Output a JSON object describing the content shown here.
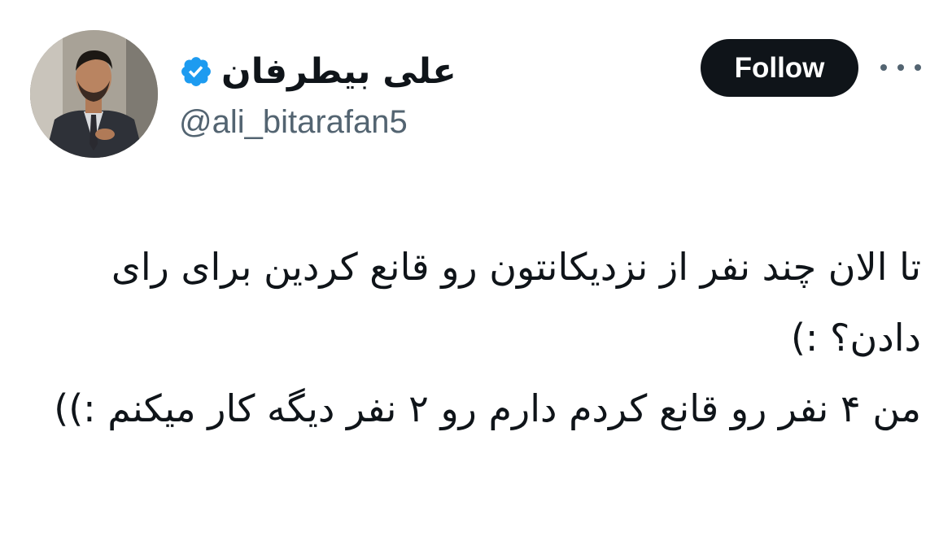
{
  "author": {
    "display_name": "علی بیطرفان",
    "handle": "@ali_bitarafan5",
    "verified_badge": "verified-badge-icon",
    "badge_color": "#1d9bf0"
  },
  "actions": {
    "follow_label": "Follow",
    "more_icon": "more-horizontal-icon"
  },
  "tweet": {
    "text": "تا الان چند نفر از نزدیکانتون رو قانع کردین برای رای دادن؟ :)\nمن ۴ نفر رو قانع کردم دارم رو ۲ نفر دیگه کار میکنم :))"
  }
}
